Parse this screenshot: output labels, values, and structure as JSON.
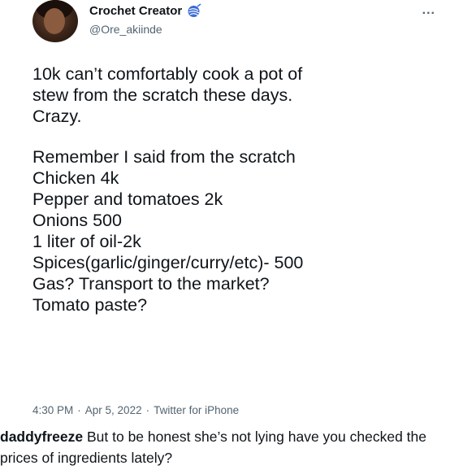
{
  "tweet": {
    "author": {
      "display_name": "Crochet Creator",
      "handle": "@Ore_akiinde",
      "badge_icon": "yarn-ball-icon",
      "badge_color": "#3a6bd6"
    },
    "more_label": "...",
    "body_lines": [
      "10k can’t comfortably cook a pot of",
      "stew from the scratch these days.",
      "Crazy."
    ],
    "list_lines": [
      "Remember I said from the scratch",
      "Chicken 4k",
      "Pepper and tomatoes 2k",
      "Onions 500",
      "1 liter of oil-2k",
      "Spices(garlic/ginger/curry/etc)- 500",
      "Gas? Transport to the market?",
      "Tomato paste?"
    ],
    "time": "4:30 PM",
    "date": "Apr 5, 2022",
    "source": "Twitter for iPhone",
    "separator": "·"
  },
  "caption": {
    "username": "daddyfreeze",
    "text": " But to be honest she’s not lying have you checked the prices of ingredients lately?"
  }
}
